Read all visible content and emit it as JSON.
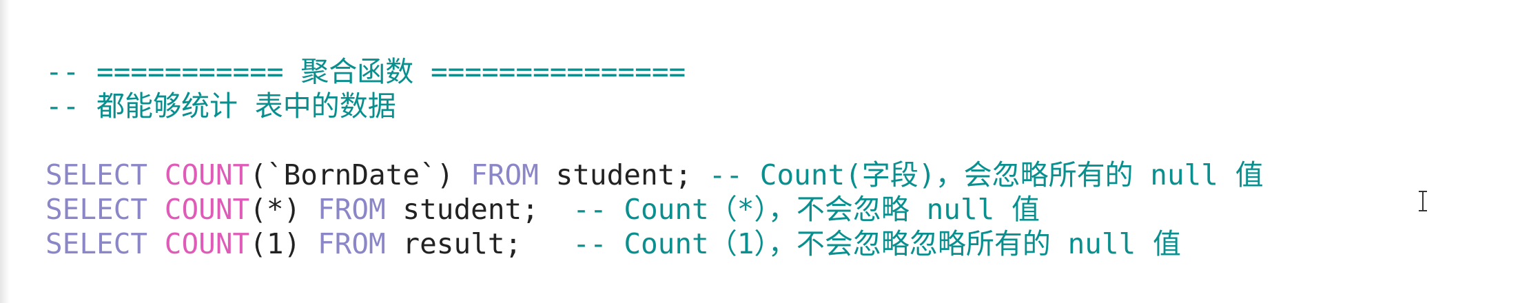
{
  "editor": {
    "lines": [
      {
        "comment": "-- =========== 聚合函数 ==============="
      },
      {
        "comment": "-- 都能够统计 表中的数据"
      },
      {
        "kw1": "SELECT",
        "fn": "COUNT",
        "arg": "(`BornDate`)",
        "kw2": "FROM",
        "rest": "student;",
        "comment": "-- Count(字段)，会忽略所有的 null 值"
      },
      {
        "kw1": "SELECT",
        "fn": "COUNT",
        "arg": "(*)",
        "kw2": "FROM",
        "rest": "student;",
        "comment": "-- Count（*），不会忽略 null 值"
      },
      {
        "kw1": "SELECT",
        "fn": "COUNT",
        "arg": "(1)",
        "kw2": "FROM",
        "rest": "result;",
        "comment": "-- Count（1），不会忽略忽略所有的 null 值"
      }
    ]
  },
  "colors": {
    "comment": "#0a8f8f",
    "keyword": "#8a86c8",
    "function": "#e05bb8",
    "text": "#222222"
  },
  "cursor": {
    "icon": "text-cursor-icon"
  }
}
